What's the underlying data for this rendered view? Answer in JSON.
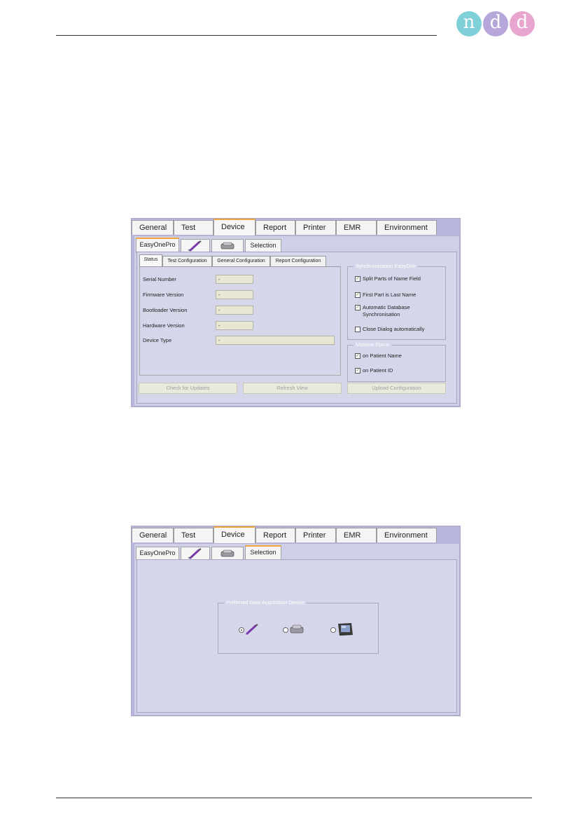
{
  "logo": {
    "letters": [
      "n",
      "d",
      "d"
    ]
  },
  "colors": {
    "accent_tab": "#f3a43b",
    "panel_bg": "#cfcfe7",
    "logo_n": "#7fd0d9",
    "logo_d1": "#b7a6d9",
    "logo_d2": "#e8a6cf"
  },
  "main_tabs": [
    "General",
    "Test",
    "Device",
    "Report",
    "Printer",
    "EMR",
    "Environment"
  ],
  "active_main_tab": "Device",
  "sub_tabs": {
    "easyonepro": "EasyOnePro",
    "spirometer_icon": "spirette-pen-icon",
    "cradle_icon": "cradle-device-icon",
    "selection": "Selection"
  },
  "screen1": {
    "active_sub_tab": "EasyOnePro",
    "inner_tabs": [
      "Status",
      "Test Configuration",
      "General Configuration",
      "Report Configuration"
    ],
    "fields": [
      {
        "label": "Serial Number",
        "value": "-"
      },
      {
        "label": "Firmware Version",
        "value": "-"
      },
      {
        "label": "Bootloader Version",
        "value": "-"
      },
      {
        "label": "Hardware Version",
        "value": "-"
      },
      {
        "label": "Device Type",
        "value": "-"
      }
    ],
    "sync_group": {
      "title": "Synchronisation EasyOne",
      "items": [
        {
          "label": "Split Parts of Name Field",
          "checked": true
        },
        {
          "label": "First Part is Last Name",
          "checked": true
        },
        {
          "label": "Automatic Database",
          "label2": "Synchronisation",
          "checked": true
        },
        {
          "label": "Close Dialog automatically",
          "checked": false
        }
      ]
    },
    "maximo_group": {
      "title": "Maximo Focus",
      "items": [
        {
          "label": "on Patient Name",
          "checked": true
        },
        {
          "label": "on Patient ID",
          "checked": true
        }
      ]
    },
    "buttons": {
      "check_updates": "Check for Updates",
      "refresh": "Refresh View",
      "upload": "Upload Configuration"
    }
  },
  "screen2": {
    "active_sub_tab": "Selection",
    "group_title": "Preferred Data Acquisition Device",
    "options": [
      {
        "icon": "spirette-pen-icon",
        "selected": true
      },
      {
        "icon": "cradle-device-icon",
        "selected": false
      },
      {
        "icon": "touchscreen-monitor-icon",
        "selected": false
      }
    ]
  }
}
